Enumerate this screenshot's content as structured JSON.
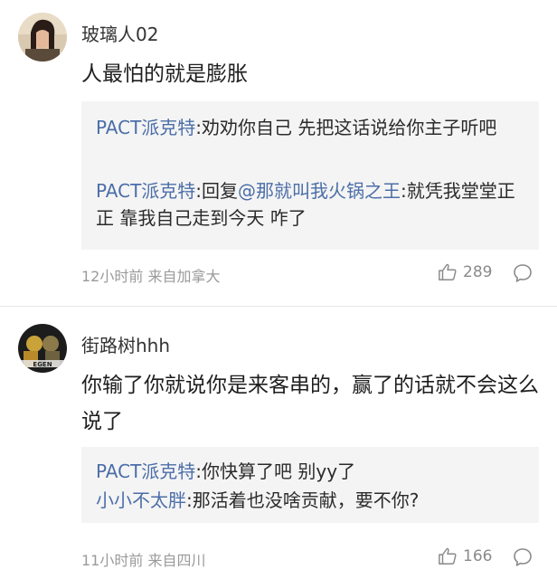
{
  "comments": [
    {
      "username": "玻璃人02",
      "text": "人最怕的就是膨胀",
      "replies": [
        {
          "author": "PACT派克特",
          "sep": ":",
          "mention": "",
          "content": "劝劝你自己 先把这话说给你主子听吧"
        },
        {
          "author": "PACT派克特",
          "sep": ":",
          "prefix": "回复",
          "mention": "@那就叫我火锅之王",
          "content": ":就凭我堂堂正正 靠我自己走到今天 咋了"
        }
      ],
      "time": "12小时前",
      "location": "来自加拿大",
      "likes": "289",
      "avatar_icon": "user-avatar-photo"
    },
    {
      "username": "街路树hhh",
      "text": "你输了你就说你是来客串的，赢了的话就不会这么说了",
      "replies": [
        {
          "author": "PACT派克特",
          "sep": ":",
          "content": "你快算了吧 别yy了"
        },
        {
          "author": "小小不太胖",
          "sep": ":",
          "content": "那活着也没啥贡献，要不你?"
        }
      ],
      "time": "11小时前",
      "location": "来自四川",
      "likes": "166",
      "avatar_icon": "user-avatar-artwork"
    }
  ],
  "colors": {
    "link": "#4b6ea8",
    "meta": "#9a9a9a",
    "reply_bg": "#f4f4f4"
  },
  "icons": {
    "like": "thumbs-up-icon",
    "reply": "speech-bubble-icon"
  }
}
